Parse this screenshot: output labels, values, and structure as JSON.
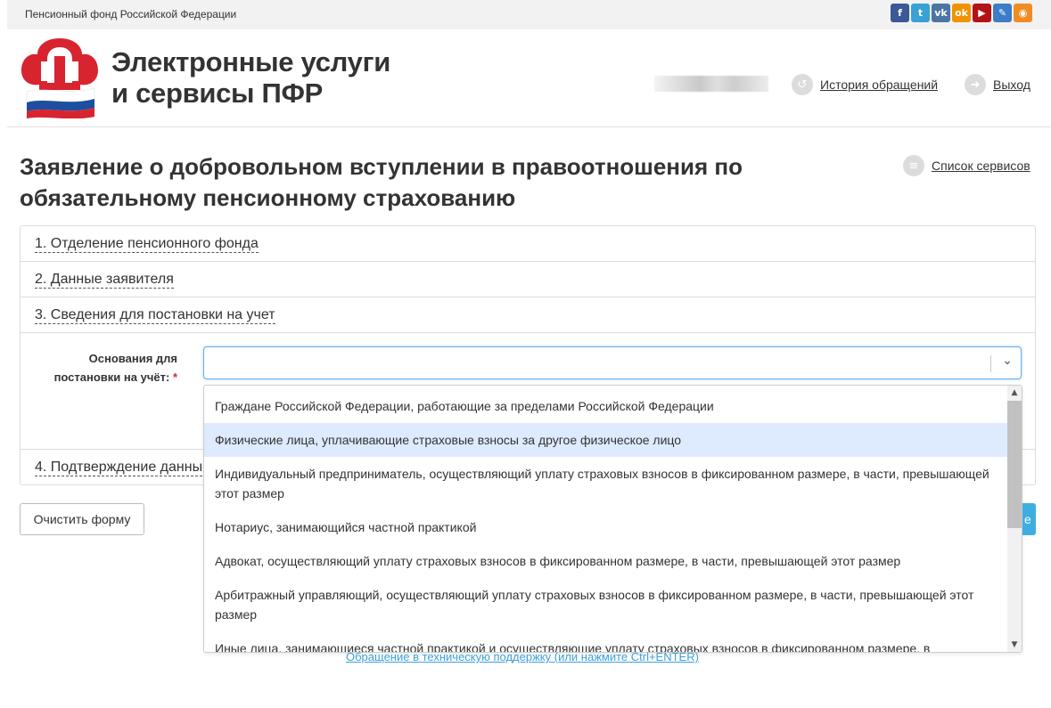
{
  "topbar": {
    "org_name": "Пенсионный фонд Российской Федерации"
  },
  "social": [
    {
      "name": "facebook-icon",
      "glyph": "f",
      "color": "#3b5998"
    },
    {
      "name": "twitter-icon",
      "glyph": "t",
      "color": "#38a1d6"
    },
    {
      "name": "vk-icon",
      "glyph": "vk",
      "color": "#4c75a3"
    },
    {
      "name": "odnoklassniki-icon",
      "glyph": "ok",
      "color": "#f29200"
    },
    {
      "name": "youtube-icon",
      "glyph": "▶",
      "color": "#b31217"
    },
    {
      "name": "livejournal-icon",
      "glyph": "✎",
      "color": "#3d7cc7"
    },
    {
      "name": "rss-icon",
      "glyph": "◉",
      "color": "#f08c23"
    }
  ],
  "header": {
    "title_line1": "Электронные услуги",
    "title_line2": "и сервисы ПФР",
    "history_label": "История обращений",
    "logout_label": "Выход"
  },
  "page": {
    "title_line1": "Заявление о добровольном вступлении в правоотношения по",
    "title_line2": "обязательному пенсионному страхованию",
    "services_label": "Список сервисов"
  },
  "sections": [
    "1. Отделение пенсионного фонда",
    "2. Данные заявителя",
    "3. Сведения для постановки на учет",
    "4. Подтверждение данны"
  ],
  "field": {
    "label_line1": "Основания для",
    "label_line2": "постановки на учёт:",
    "required_mark": "*",
    "value": ""
  },
  "dropdown_options": [
    "Граждане Российской Федерации, работающие за пределами Российской Федерации",
    "Физические лица, уплачивающие страховые взносы за другое физическое лицо",
    "Индивидуальный предприниматель, осуществляющий уплату страховых взносов в фиксированном размере, в части, превышающей этот размер",
    "Нотариус, занимающийся частной практикой",
    "Адвокат, осуществляющий уплату страховых взносов в фиксированном размере, в части, превышающей этот размер",
    "Арбитражный управляющий, осуществляющий уплату страховых взносов в фиксированном размере, в части, превышающей этот размер",
    "Иные лица, занимающиеся частной практикой и осуществляющие уплату страховых взносов в фиксированном размере, в"
  ],
  "highlighted_option_index": 1,
  "buttons": {
    "clear_label": "Очистить форму",
    "next_label": "е"
  },
  "footer": {
    "support_label": "Обращение в техническую поддержку (или нажмите Ctrl+ENTER)"
  }
}
